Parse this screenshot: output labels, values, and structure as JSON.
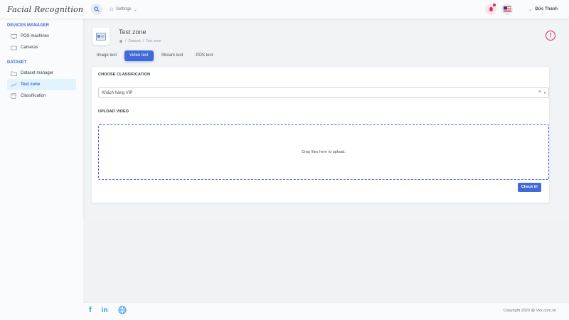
{
  "header": {
    "logo": "Facial Recognition",
    "settings_label": "Settings",
    "user_name": "Đức Thành"
  },
  "sidebar": {
    "sections": [
      {
        "title": "DEVICES MANAGER",
        "items": [
          {
            "label": "POS machines"
          },
          {
            "label": "Cameras"
          }
        ]
      },
      {
        "title": "DATASET",
        "items": [
          {
            "label": "Dataset manager"
          },
          {
            "label": "Test zone"
          },
          {
            "label": "Classification"
          }
        ]
      }
    ]
  },
  "page": {
    "title": "Test zone",
    "breadcrumb": [
      "Dataset",
      "Test zone"
    ],
    "tabs": [
      {
        "label": "Image test"
      },
      {
        "label": "Video test"
      },
      {
        "label": "Stream test"
      },
      {
        "label": "POS test"
      }
    ]
  },
  "form": {
    "classification_label": "CHOOSE CLASSIFICATION",
    "classification_value": "Khách hàng VIP",
    "upload_label": "UPLOAD VIDEO",
    "dropzone_text": "Drop files here to upload.",
    "submit_label": "Check it!"
  },
  "footer": {
    "copyright": "Copyright 2020 @ Vkx.com.vn",
    "social": [
      "f",
      "in",
      "globe"
    ]
  },
  "colors": {
    "primary": "#3f6ad8",
    "danger": "#d92550",
    "active_bg": "#e0f3ff"
  }
}
